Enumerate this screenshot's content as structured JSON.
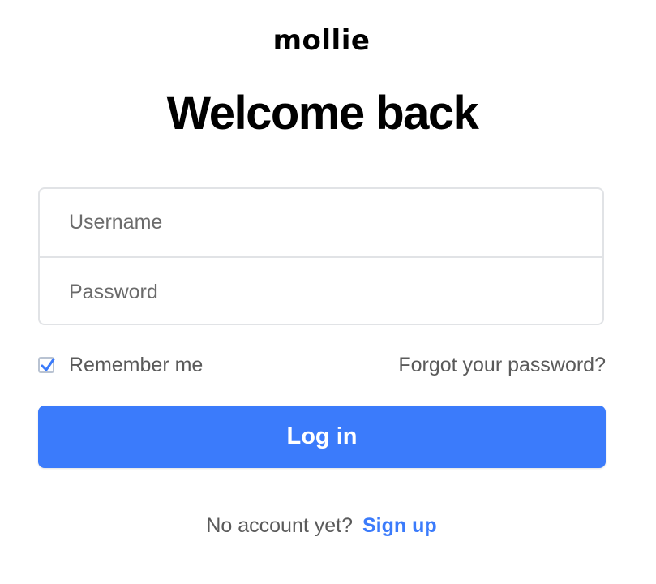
{
  "brand": {
    "logo_text": "mollie"
  },
  "header": {
    "title": "Welcome back"
  },
  "form": {
    "username_placeholder": "Username",
    "password_placeholder": "Password",
    "remember_label": "Remember me",
    "remember_checked": true,
    "forgot_label": "Forgot your password?",
    "login_label": "Log in"
  },
  "footer": {
    "prompt": "No account yet?",
    "signup_label": "Sign up"
  },
  "colors": {
    "accent": "#3b7bfb",
    "border": "#e1e3e6",
    "muted_text": "#5a5a5a"
  },
  "icons": {
    "checkbox_checked": "checkmark-icon"
  }
}
